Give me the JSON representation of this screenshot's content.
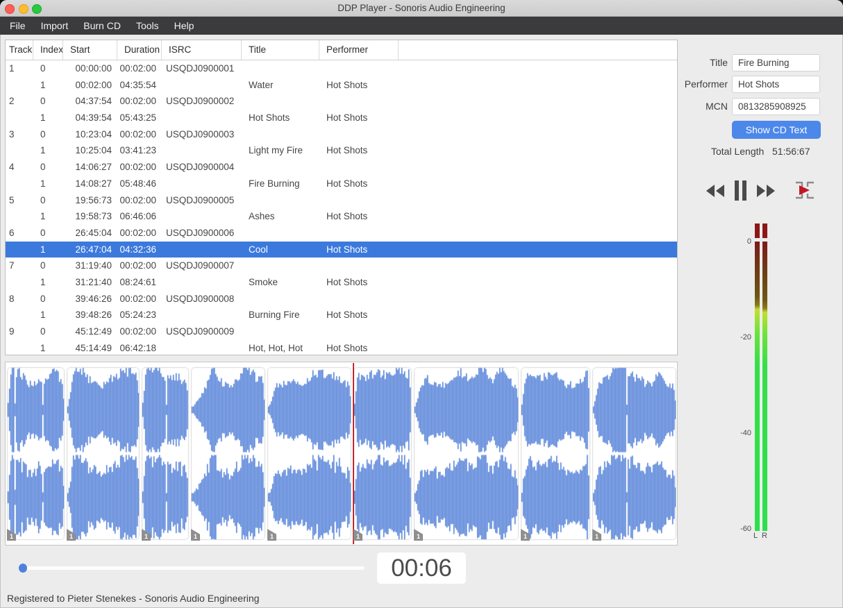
{
  "window": {
    "title": "DDP Player - Sonoris Audio Engineering"
  },
  "menubar": {
    "items": [
      "File",
      "Import",
      "Burn CD",
      "Tools",
      "Help"
    ]
  },
  "table": {
    "columns": [
      "Track",
      "Index",
      "Start",
      "Duration",
      "ISRC",
      "Title",
      "Performer"
    ],
    "rows": [
      {
        "track": "1",
        "index": "0",
        "start": "00:00:00",
        "duration": "00:02:00",
        "isrc": "USQDJ0900001",
        "title": "",
        "performer": "",
        "selected": false
      },
      {
        "track": "",
        "index": "1",
        "start": "00:02:00",
        "duration": "04:35:54",
        "isrc": "",
        "title": "Water",
        "performer": "Hot Shots",
        "selected": false
      },
      {
        "track": "2",
        "index": "0",
        "start": "04:37:54",
        "duration": "00:02:00",
        "isrc": "USQDJ0900002",
        "title": "",
        "performer": "",
        "selected": false
      },
      {
        "track": "",
        "index": "1",
        "start": "04:39:54",
        "duration": "05:43:25",
        "isrc": "",
        "title": "Hot Shots",
        "performer": "Hot Shots",
        "selected": false
      },
      {
        "track": "3",
        "index": "0",
        "start": "10:23:04",
        "duration": "00:02:00",
        "isrc": "USQDJ0900003",
        "title": "",
        "performer": "",
        "selected": false
      },
      {
        "track": "",
        "index": "1",
        "start": "10:25:04",
        "duration": "03:41:23",
        "isrc": "",
        "title": "Light my Fire",
        "performer": "Hot Shots",
        "selected": false
      },
      {
        "track": "4",
        "index": "0",
        "start": "14:06:27",
        "duration": "00:02:00",
        "isrc": "USQDJ0900004",
        "title": "",
        "performer": "",
        "selected": false
      },
      {
        "track": "",
        "index": "1",
        "start": "14:08:27",
        "duration": "05:48:46",
        "isrc": "",
        "title": "Fire Burning",
        "performer": "Hot Shots",
        "selected": false
      },
      {
        "track": "5",
        "index": "0",
        "start": "19:56:73",
        "duration": "00:02:00",
        "isrc": "USQDJ0900005",
        "title": "",
        "performer": "",
        "selected": false
      },
      {
        "track": "",
        "index": "1",
        "start": "19:58:73",
        "duration": "06:46:06",
        "isrc": "",
        "title": "Ashes",
        "performer": "Hot Shots",
        "selected": false
      },
      {
        "track": "6",
        "index": "0",
        "start": "26:45:04",
        "duration": "00:02:00",
        "isrc": "USQDJ0900006",
        "title": "",
        "performer": "",
        "selected": false
      },
      {
        "track": "",
        "index": "1",
        "start": "26:47:04",
        "duration": "04:32:36",
        "isrc": "",
        "title": "Cool",
        "performer": "Hot Shots",
        "selected": true
      },
      {
        "track": "7",
        "index": "0",
        "start": "31:19:40",
        "duration": "00:02:00",
        "isrc": "USQDJ0900007",
        "title": "",
        "performer": "",
        "selected": false
      },
      {
        "track": "",
        "index": "1",
        "start": "31:21:40",
        "duration": "08:24:61",
        "isrc": "",
        "title": "Smoke",
        "performer": "Hot Shots",
        "selected": false
      },
      {
        "track": "8",
        "index": "0",
        "start": "39:46:26",
        "duration": "00:02:00",
        "isrc": "USQDJ0900008",
        "title": "",
        "performer": "",
        "selected": false
      },
      {
        "track": "",
        "index": "1",
        "start": "39:48:26",
        "duration": "05:24:23",
        "isrc": "",
        "title": "Burning Fire",
        "performer": "Hot Shots",
        "selected": false
      },
      {
        "track": "9",
        "index": "0",
        "start": "45:12:49",
        "duration": "00:02:00",
        "isrc": "USQDJ0900009",
        "title": "",
        "performer": "",
        "selected": false
      },
      {
        "track": "",
        "index": "1",
        "start": "45:14:49",
        "duration": "06:42:18",
        "isrc": "",
        "title": "Hot, Hot, Hot",
        "performer": "Hot Shots",
        "selected": false
      }
    ]
  },
  "cd_text": {
    "title_label": "Title",
    "title_value": "Fire Burning",
    "performer_label": "Performer",
    "performer_value": "Hot Shots",
    "mcn_label": "MCN",
    "mcn_value": "0813285908925",
    "show_cd_text_button": "Show CD Text",
    "total_length_label": "Total Length",
    "total_length_value": "51:56:67"
  },
  "meter": {
    "ticks": [
      "0",
      "-20",
      "-40",
      "-60"
    ],
    "channels": [
      "L",
      "R"
    ]
  },
  "waveform": {
    "segments": [
      {
        "index_label": "1"
      },
      {
        "index_label": "1"
      },
      {
        "index_label": "1"
      },
      {
        "index_label": "1"
      },
      {
        "index_label": "1"
      },
      {
        "index_label": "1"
      },
      {
        "index_label": "1"
      },
      {
        "index_label": "1"
      },
      {
        "index_label": "1"
      }
    ]
  },
  "player": {
    "time_display": "00:06"
  },
  "status_bar": {
    "text": "Registered to Pieter Stenekes - Sonoris Audio Engineering"
  },
  "colors": {
    "selection_blue": "#3b79dd",
    "waveform_blue": "#3b6fd3",
    "button_blue": "#4c87ea",
    "playhead_red": "#c1272d",
    "meter_over_red": "#8d1717",
    "meter_green": "#2ce04c"
  }
}
